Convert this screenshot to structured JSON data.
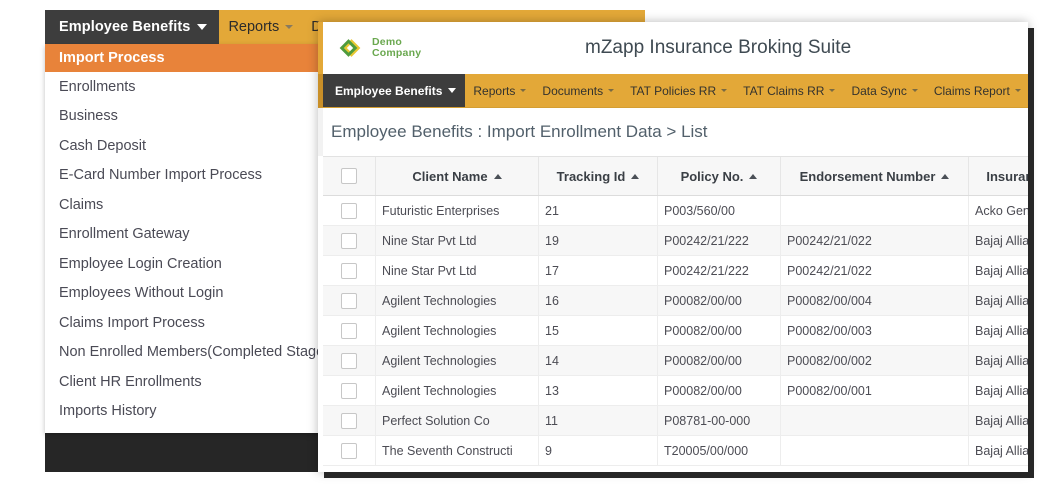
{
  "back_window": {
    "navbar": {
      "active_label": "Employee Benefits",
      "items": [
        {
          "label": "Reports",
          "has_caret": true
        },
        {
          "label": "Docum",
          "has_caret": false
        }
      ]
    },
    "dropdown": {
      "items": [
        {
          "label": "Import Process",
          "active": true
        },
        {
          "label": "Enrollments",
          "active": false
        },
        {
          "label": "Business",
          "active": false
        },
        {
          "label": "Cash Deposit",
          "active": false
        },
        {
          "label": "E-Card Number Import Process",
          "active": false
        },
        {
          "label": "Claims",
          "active": false
        },
        {
          "label": "Enrollment Gateway",
          "active": false
        },
        {
          "label": "Employee Login Creation",
          "active": false
        },
        {
          "label": "Employees Without Login",
          "active": false
        },
        {
          "label": "Claims Import Process",
          "active": false
        },
        {
          "label": "Non Enrolled Members(Completed Stage)",
          "active": false
        },
        {
          "label": "Client HR Enrollments",
          "active": false
        },
        {
          "label": "Imports History",
          "active": false
        }
      ]
    }
  },
  "front_window": {
    "logo": {
      "line1": "Demo",
      "line2": "Company",
      "icon": "diamond-logo-icon",
      "color_green": "#6aa84f",
      "color_yellow": "#e8c832"
    },
    "app_title": "mZapp Insurance Broking Suite",
    "navbar": {
      "active_label": "Employee Benefits",
      "items": [
        "Reports",
        "Documents",
        "TAT Policies RR",
        "TAT Claims RR",
        "Data Sync",
        "Claims Report"
      ],
      "accent": "#e3a838"
    },
    "breadcrumb": "Employee Benefits : Import Enrollment Data > List",
    "table": {
      "columns": [
        {
          "key": "chk",
          "label": "",
          "sortable": false
        },
        {
          "key": "name",
          "label": "Client Name",
          "sortable": true
        },
        {
          "key": "track",
          "label": "Tracking Id",
          "sortable": true
        },
        {
          "key": "pol",
          "label": "Policy No.",
          "sortable": true
        },
        {
          "key": "end",
          "label": "Endorsement Number",
          "sortable": true
        },
        {
          "key": "ins",
          "label": "Insurance Company N",
          "sortable": false
        }
      ],
      "rows": [
        {
          "name": "Futuristic Enterprises",
          "track": "21",
          "pol": "P003/560/00",
          "end": "",
          "ins": "Acko General Insu..."
        },
        {
          "name": "Nine Star Pvt Ltd",
          "track": "19",
          "pol": "P00242/21/222",
          "end": "P00242/21/022",
          "ins": "Bajaj Allianz Gen..."
        },
        {
          "name": "Nine Star Pvt Ltd",
          "track": "17",
          "pol": "P00242/21/222",
          "end": "P00242/21/022",
          "ins": "Bajaj Allianz Gen..."
        },
        {
          "name": "Agilent Technologies",
          "track": "16",
          "pol": "P00082/00/00",
          "end": "P00082/00/004",
          "ins": "Bajaj Allianz Gen..."
        },
        {
          "name": "Agilent Technologies",
          "track": "15",
          "pol": "P00082/00/00",
          "end": "P00082/00/003",
          "ins": "Bajaj Allianz Gen..."
        },
        {
          "name": "Agilent Technologies",
          "track": "14",
          "pol": "P00082/00/00",
          "end": "P00082/00/002",
          "ins": "Bajaj Allianz Gen..."
        },
        {
          "name": "Agilent Technologies",
          "track": "13",
          "pol": "P00082/00/00",
          "end": "P00082/00/001",
          "ins": "Bajaj Allianz Gen..."
        },
        {
          "name": "Perfect Solution Co",
          "track": "11",
          "pol": "P08781-00-000",
          "end": "",
          "ins": "Bajaj Allianz Gen..."
        },
        {
          "name": "The Seventh Constructi",
          "track": "9",
          "pol": "T20005/00/000",
          "end": "",
          "ins": "Bajaj Allianz Gen..."
        }
      ]
    }
  }
}
